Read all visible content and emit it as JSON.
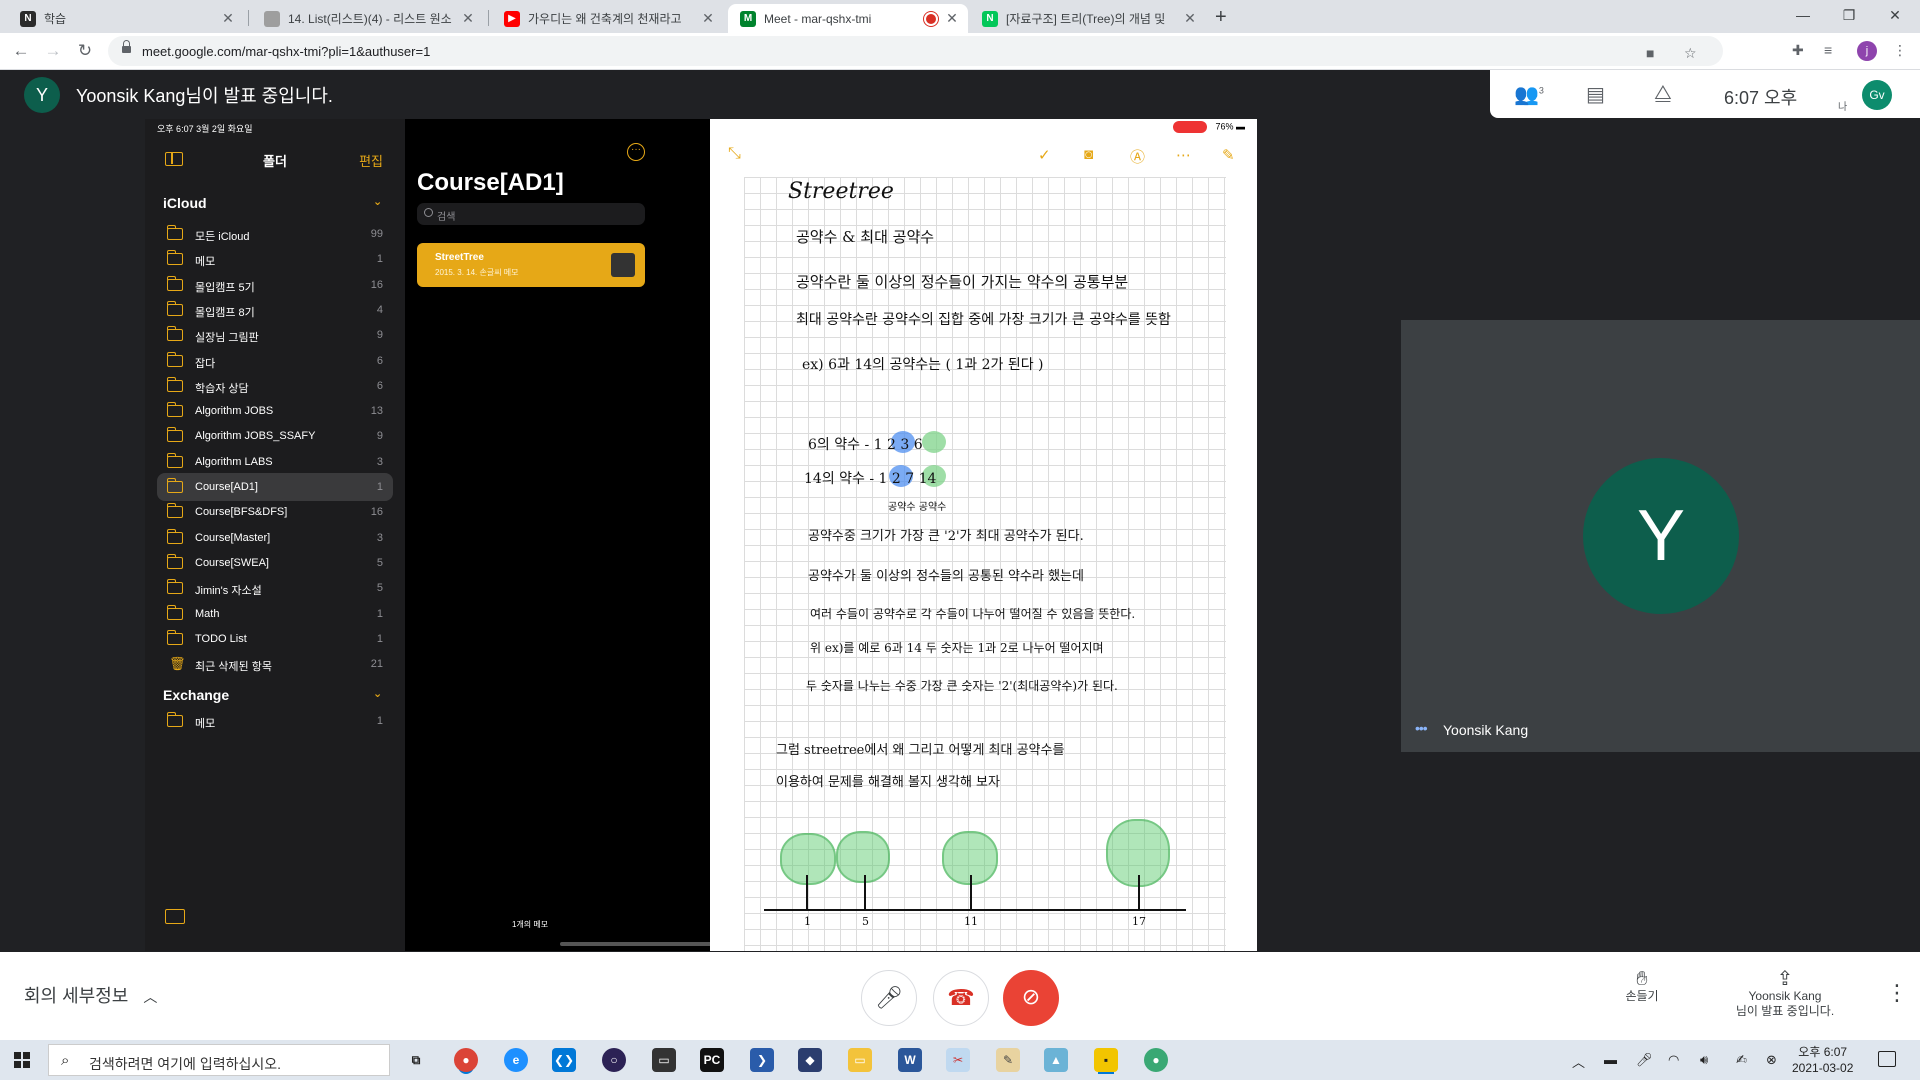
{
  "browser": {
    "tabs": [
      {
        "title": "학습",
        "favicon_color": "#2b2b2b",
        "favicon_text": "N"
      },
      {
        "title": "14. List(리스트)(4) - 리스트 원소",
        "favicon_color": "#9e9e9e",
        "favicon_text": ""
      },
      {
        "title": "가우디는 왜 건축계의 천재라고",
        "favicon_color": "#ff0000",
        "favicon_text": "▶"
      },
      {
        "title": "Meet - mar-qshx-tmi",
        "favicon_color": "#00832d",
        "favicon_text": "M"
      },
      {
        "title": "[자료구조] 트리(Tree)의 개념 및",
        "favicon_color": "#03c75a",
        "favicon_text": "N"
      }
    ],
    "active_tab_index": 3,
    "url": "meet.google.com/mar-qshx-tmi?pli=1&authuser=1",
    "profile_initial": "j"
  },
  "meet": {
    "presenter_initial": "Y",
    "presenter_banner": "Yoonsik Kang님이 발표 중입니다.",
    "participant_count": "3",
    "time": "6:07 오후",
    "self_avatar": "Gv",
    "self_label": "나",
    "tile_initial": "Y",
    "tile_name": "Yoonsik Kang",
    "meeting_details": "회의 세부정보",
    "raise_hand": "손들기",
    "presenting_name": "Yoonsik Kang",
    "presenting_label": "님이 발표 중입니다.",
    "hangup_color": "#d93025",
    "camera_off_color": "#ea4335"
  },
  "ipad": {
    "status_left": "오후 6:07   3월 2일 화요일",
    "status_right": "76%",
    "folders_title": "폴더",
    "edit": "편집",
    "icloud": "iCloud",
    "folders": [
      {
        "name": "모든 iCloud",
        "count": "99"
      },
      {
        "name": "메모",
        "count": "1"
      },
      {
        "name": "몰입캠프 5기",
        "count": "16"
      },
      {
        "name": "몰입캠프 8기",
        "count": "4"
      },
      {
        "name": "실장님 그림판",
        "count": "9"
      },
      {
        "name": "잡다",
        "count": "6"
      },
      {
        "name": "학습자 상담",
        "count": "6"
      },
      {
        "name": "Algorithm JOBS",
        "count": "13"
      },
      {
        "name": "Algorithm JOBS_SSAFY",
        "count": "9"
      },
      {
        "name": "Algorithm LABS",
        "count": "3"
      },
      {
        "name": "Course[AD1]",
        "count": "1"
      },
      {
        "name": "Course[BFS&DFS]",
        "count": "16"
      },
      {
        "name": "Course[Master]",
        "count": "3"
      },
      {
        "name": "Course[SWEA]",
        "count": "5"
      },
      {
        "name": "Jimin's 자소설",
        "count": "5"
      },
      {
        "name": "Math",
        "count": "1"
      },
      {
        "name": "TODO List",
        "count": "1"
      },
      {
        "name": "최근 삭제된 항목",
        "count": "21"
      }
    ],
    "selected_folder_index": 10,
    "exchange": "Exchange",
    "exchange_folders": [
      {
        "name": "메모",
        "count": "1"
      }
    ],
    "list_title": "Course[AD1]",
    "search_placeholder": "검색",
    "note_title": "StreetTree",
    "note_sub": "2015. 3. 14.  손글씨 메모",
    "note_count": "1개의 메모",
    "accent_color": "#e6a817"
  },
  "handwriting": {
    "title": "Streetree",
    "lines": [
      "공약수 & 최대 공약수",
      "공약수란 둘 이상의 정수들이 가지는 약수의 공통부분",
      "최대 공약수란 공약수의 집합 중에 가장 크기가 큰 공약수를 뜻함",
      "ex)  6과 14의 공약수는  ( 1과 2가 된다 )",
      "6의 약수 -  1   2   3   6",
      "14의 약수 -  1   2   7   14",
      "공약수   공약수",
      "공약수중 크기가 가장 큰 '2'가 최대 공약수가 된다.",
      "공약수가 둘 이상의 정수들의 공통된 약수라 했는데",
      "여러 수들이 공약수로 각 수들이 나누어 떨어질 수 있음을 뜻한다.",
      "위 ex)를 예로 6과 14 두 숫자는 1과 2로 나누어 떨어지며",
      "두 숫자를 나누는 수중 가장 큰 숫자는 '2'(최대공약수)가 된다.",
      "그럼 streetree에서 왜 그리고 어떻게 최대 공약수를",
      "이용하여 문제를 해결해 볼지 생각해 보자"
    ],
    "tree_positions": [
      "1",
      "5",
      "11",
      "17"
    ]
  },
  "taskbar": {
    "search_placeholder": "검색하려면 여기에 입력하십시오.",
    "time": "오후 6:07",
    "date": "2021-03-02"
  }
}
